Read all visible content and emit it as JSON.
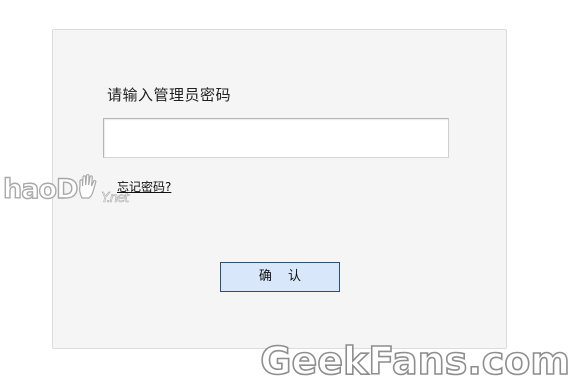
{
  "dialog": {
    "prompt_label": "请输入管理员密码",
    "password_value": "",
    "forgot_link": "忘记密码?",
    "confirm_label": "确 认"
  },
  "watermarks": {
    "left_text": "haoD",
    "left_suffix": "Y.net",
    "right_text": "GeekFans.com"
  },
  "colors": {
    "panel_bg": "#f5f5f5",
    "button_bg": "#d9e7fb",
    "button_border": "#2f4f6f"
  },
  "icons": {
    "watermark_hand": "hand-icon"
  }
}
